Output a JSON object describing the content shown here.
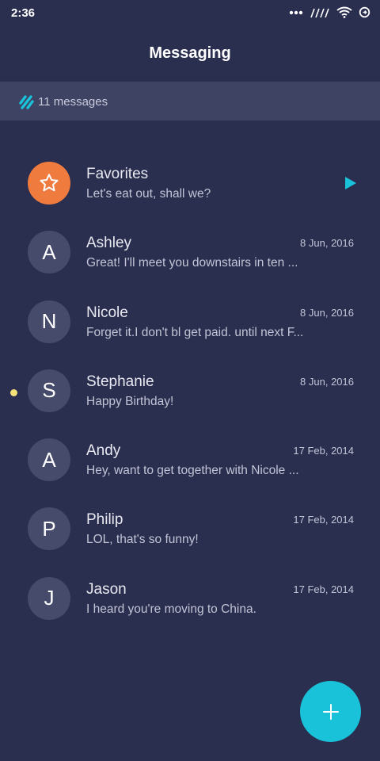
{
  "status_bar": {
    "time": "2:36",
    "icons": [
      "more-dots-icon",
      "signal-icon",
      "wifi-icon",
      "sync-icon"
    ]
  },
  "header": {
    "title": "Messaging"
  },
  "summary": {
    "count_label": "11 messages",
    "icon": "logo-slashes-icon"
  },
  "conversations": [
    {
      "initial": "★",
      "name": "Favorites",
      "preview": "Let's eat out, shall we?",
      "date": "",
      "favorite": true,
      "icon": "play-icon"
    },
    {
      "initial": "A",
      "name": "Ashley",
      "preview": "Great! I'll meet you downstairs in ten ...",
      "date": "8 Jun, 2016"
    },
    {
      "initial": "N",
      "name": "Nicole",
      "preview": "Forget it.I don't bl get paid. until next F...",
      "date": "8 Jun, 2016"
    },
    {
      "initial": "S",
      "name": "Stephanie",
      "preview": "Happy Birthday!",
      "date": "8 Jun, 2016",
      "unread": true
    },
    {
      "initial": "A",
      "name": "Andy",
      "preview": "Hey, want to get together with Nicole ...",
      "date": "17 Feb, 2014"
    },
    {
      "initial": "P",
      "name": "Philip",
      "preview": "LOL, that's so funny!",
      "date": "17 Feb, 2014"
    },
    {
      "initial": "J",
      "name": "Jason",
      "preview": "I heard you're moving to China.",
      "date": "17 Feb, 2014"
    }
  ],
  "fab": {
    "label": "+",
    "icon": "plus-icon"
  },
  "colors": {
    "background": "#2a2e4f",
    "accent": "#19c2d9",
    "favorite": "#f07b3f",
    "unread": "#f5e27a",
    "avatar": "#474b6b"
  }
}
